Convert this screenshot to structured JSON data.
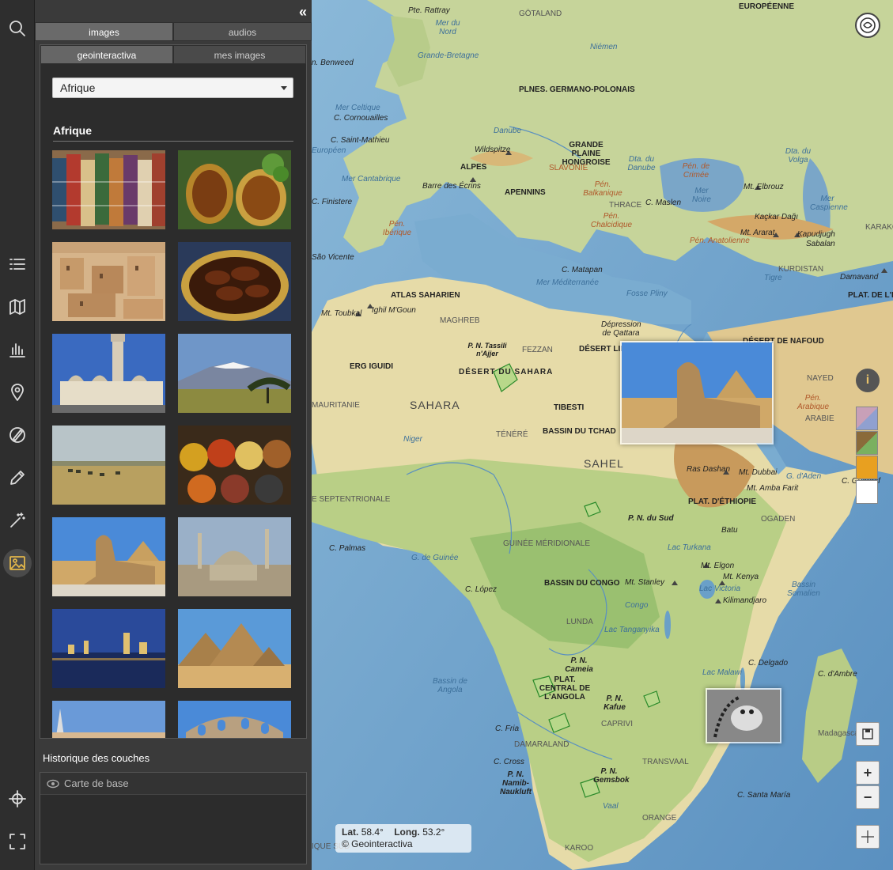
{
  "panel": {
    "collapse_label": "«",
    "tabs": [
      "images",
      "audios"
    ],
    "subtabs": [
      "geointeractiva",
      "mes images"
    ],
    "region_select": "Afrique",
    "section_title": "Afrique",
    "history_title": "Historique des couches",
    "layers": [
      "Carte de base"
    ]
  },
  "toolbar": {
    "icons": [
      "search-icon",
      "list-icon",
      "map-icon",
      "chart-icon",
      "pin-icon",
      "compass-draw-icon",
      "pencil-icon",
      "magic-wand-icon",
      "image-icon",
      "crosshair-icon",
      "fullscreen-icon"
    ],
    "active": "image-icon"
  },
  "thumbnails": [
    "carpets",
    "mint-tea",
    "kasbah",
    "dates",
    "hassan-mosque",
    "kilimanjaro",
    "savanna",
    "spices",
    "sphinx",
    "cairo-mosques",
    "night-city",
    "pyramids",
    "ruins",
    "amphitheatre"
  ],
  "map": {
    "coords": {
      "lat_label": "Lat.",
      "lat": "58.4°",
      "long_label": "Long.",
      "long": "53.2°",
      "copyright": "© Geointeractiva"
    },
    "labels": {
      "eu": "EUROPÉENNE",
      "gotaland": "GÖTALAND",
      "rattray": "Pte. Rattray",
      "mernord": "Mer du Nord",
      "gb": "Grande-Bretagne",
      "niemen": "Niémen",
      "benweed": "n. Benweed",
      "germano": "PLNES. GERMANO-POLONAIS",
      "celtique": "Mer Celtique",
      "cornouailles": "C. Cornouailles",
      "stmathieu": "C. Saint-Mathieu",
      "europeen": "Européen",
      "wildspitze": "Wildspitze",
      "hongroise": "GRANDE PLAINE HONGROISE",
      "alpes": "ALPES",
      "slavonie": "SLAVONIE",
      "danube": "Danube",
      "dtadanube": "Dta. du Danube",
      "dtavolga": "Dta. du Volga",
      "crimee": "Pén. de Crimée",
      "barre": "Barre des Écrins",
      "cantabrique": "Mer Cantabrique",
      "finistere": "C. Finistere",
      "apennins": "APENNINS",
      "balkanique": "Pén. Balkanique",
      "thrace": "THRACE",
      "maslen": "C. Maslen",
      "mernoire": "Mer Noire",
      "elbrouz": "Mt. Elbrouz",
      "caspienne": "Mer Caspienne",
      "karako": "KARAKO",
      "iberique": "Pén. Ibérique",
      "chalcidique": "Pén. Chalcidique",
      "kackar": "Kaçkar Dağı",
      "ararat": "Mt. Ararat",
      "anatolienne": "Pén. Anatolienne",
      "kapudjugh": "Kapudjugh",
      "sabalan": "Sabalan",
      "saovicente": "São Vicente",
      "matapan": "C. Matapan",
      "kurdistan": "KURDISTAN",
      "damavand": "Damavand",
      "mermed": "Mer Méditerranée",
      "fosse": "Fosse Pliny",
      "atlas": "ATLAS SAHARIEN",
      "ighil": "Ighil M'Goun",
      "toubkal": "Mt. Toubkal",
      "maghreb": "MAGHREB",
      "plativ": "PLAT. DE L'IR",
      "qattara": "Dépression de Qattara",
      "tassili": "P. N. Tassili n'Ajjer",
      "fezzan": "FEZZAN",
      "desertlib": "DÉSERT LIBY",
      "nafoud": "DÉSERT DE NAFOUD",
      "erg": "ERG IGUIDI",
      "desertsahara": "DÉSERT DU SAHARA",
      "nayed": "NAYED",
      "mauritanie": "MAURITANIE",
      "sahara": "SAHARA",
      "tibesti": "TIBESTI",
      "penarabique": "Pén. Arabique",
      "arabie": "ARABIE",
      "tenere": "TÉNÉRÉ",
      "tchad": "BASSIN DU TCHAD",
      "niger": "Niger",
      "sahel": "SAHEL",
      "rasdashan": "Ras Dashan",
      "dubbai": "Mt. Dubbai",
      "gaden": "G. d'Aden",
      "guardaf": "C. Guardaf",
      "ambafarit": "Mt. Amba Farit",
      "septentrionale": "E SEPTENTRIONALE",
      "ethiopie": "PLAT. D'ÉTHIOPIE",
      "pndusud": "P. N. du Sud",
      "ogaden": "OGADEN",
      "batu": "Batu",
      "palmas": "C. Palmas",
      "guinee": "GUINÉE MÉRIDIONALE",
      "turkana": "Lac Turkana",
      "gguinee": "G. de Guinée",
      "elgon": "Mt. Elgon",
      "kenya": "Mt. Kenya",
      "lopez": "C. López",
      "congo": "BASSIN DU CONGO",
      "stanley": "Mt. Stanley",
      "victoria": "Lac Victoria",
      "kilimandjaro": "Kilimandjaro",
      "somalien": "Bassin Somalien",
      "lunda": "LUNDA",
      "tanganyika": "Lac Tanganyika",
      "cameia": "P. N. Cameia",
      "delgado": "C. Delgado",
      "angola": "Bassin de Angola",
      "malawi": "Lac Malawi",
      "ambre": "C. d'Ambre",
      "platangola": "PLAT. CENTRAL DE L'ANGOLA",
      "kafue": "P. N. Kafue",
      "caprivi": "CAPRIVI",
      "madagascar": "Madagasca",
      "fria": "C. Fria",
      "damaraland": "DAMARALAND",
      "cross": "C. Cross",
      "namib": "P. N. Namib-Naukluft",
      "gemsbok": "P. N. Gemsbok",
      "transvaal": "TRANSVAAL",
      "santamaria": "C. Santa María",
      "orange": "ORANGE",
      "vaal": "Vaal",
      "karoo": "KAROO",
      "iquesud": "IQUE SUD",
      "tigre": "Tigre",
      "congo_r": "Congo"
    }
  }
}
